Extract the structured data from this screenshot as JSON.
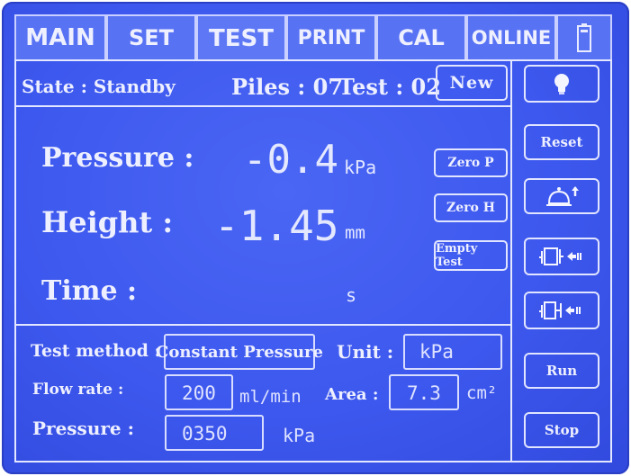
{
  "tabs": [
    {
      "label": "MAIN"
    },
    {
      "label": "SET"
    },
    {
      "label": "TEST"
    },
    {
      "label": "PRINT"
    },
    {
      "label": "CAL"
    },
    {
      "label": "ONLINE"
    }
  ],
  "active_tab": "TEST",
  "status": {
    "state": "State : Standby",
    "piles": "Piles : 07",
    "test": "Test : 02",
    "new_button": "New"
  },
  "readings": {
    "pressure_label": "Pressure :",
    "pressure_value": "-0.4",
    "pressure_unit": "kPa",
    "height_label": "Height :",
    "height_value": "-1.45",
    "height_unit": "mm",
    "time_label": "Time :",
    "time_unit": "s"
  },
  "mid_buttons": {
    "zero_p": "Zero P",
    "zero_h": "Zero H",
    "empty_test": "Empty Test"
  },
  "side_buttons": {
    "reset": "Reset",
    "run": "Run",
    "stop": "Stop"
  },
  "settings": {
    "method_label": "Test method :",
    "method_value": "Constant Pressure",
    "unit_label": "Unit :",
    "unit_value": "kPa",
    "flow_label": "Flow rate :",
    "flow_value": "200",
    "flow_unit": "ml/min",
    "area_label": "Area :",
    "area_value": "7.3",
    "area_unit": "cm²",
    "pressure_label": "Pressure :",
    "pressure_value": "0350",
    "pressure_unit": "kPa"
  },
  "icons": {
    "battery": "battery-icon",
    "light": "lightbulb-icon",
    "bell": "bell-up-icon",
    "clamp_open": "clamp-release-icon",
    "clamp_close": "clamp-press-icon"
  }
}
